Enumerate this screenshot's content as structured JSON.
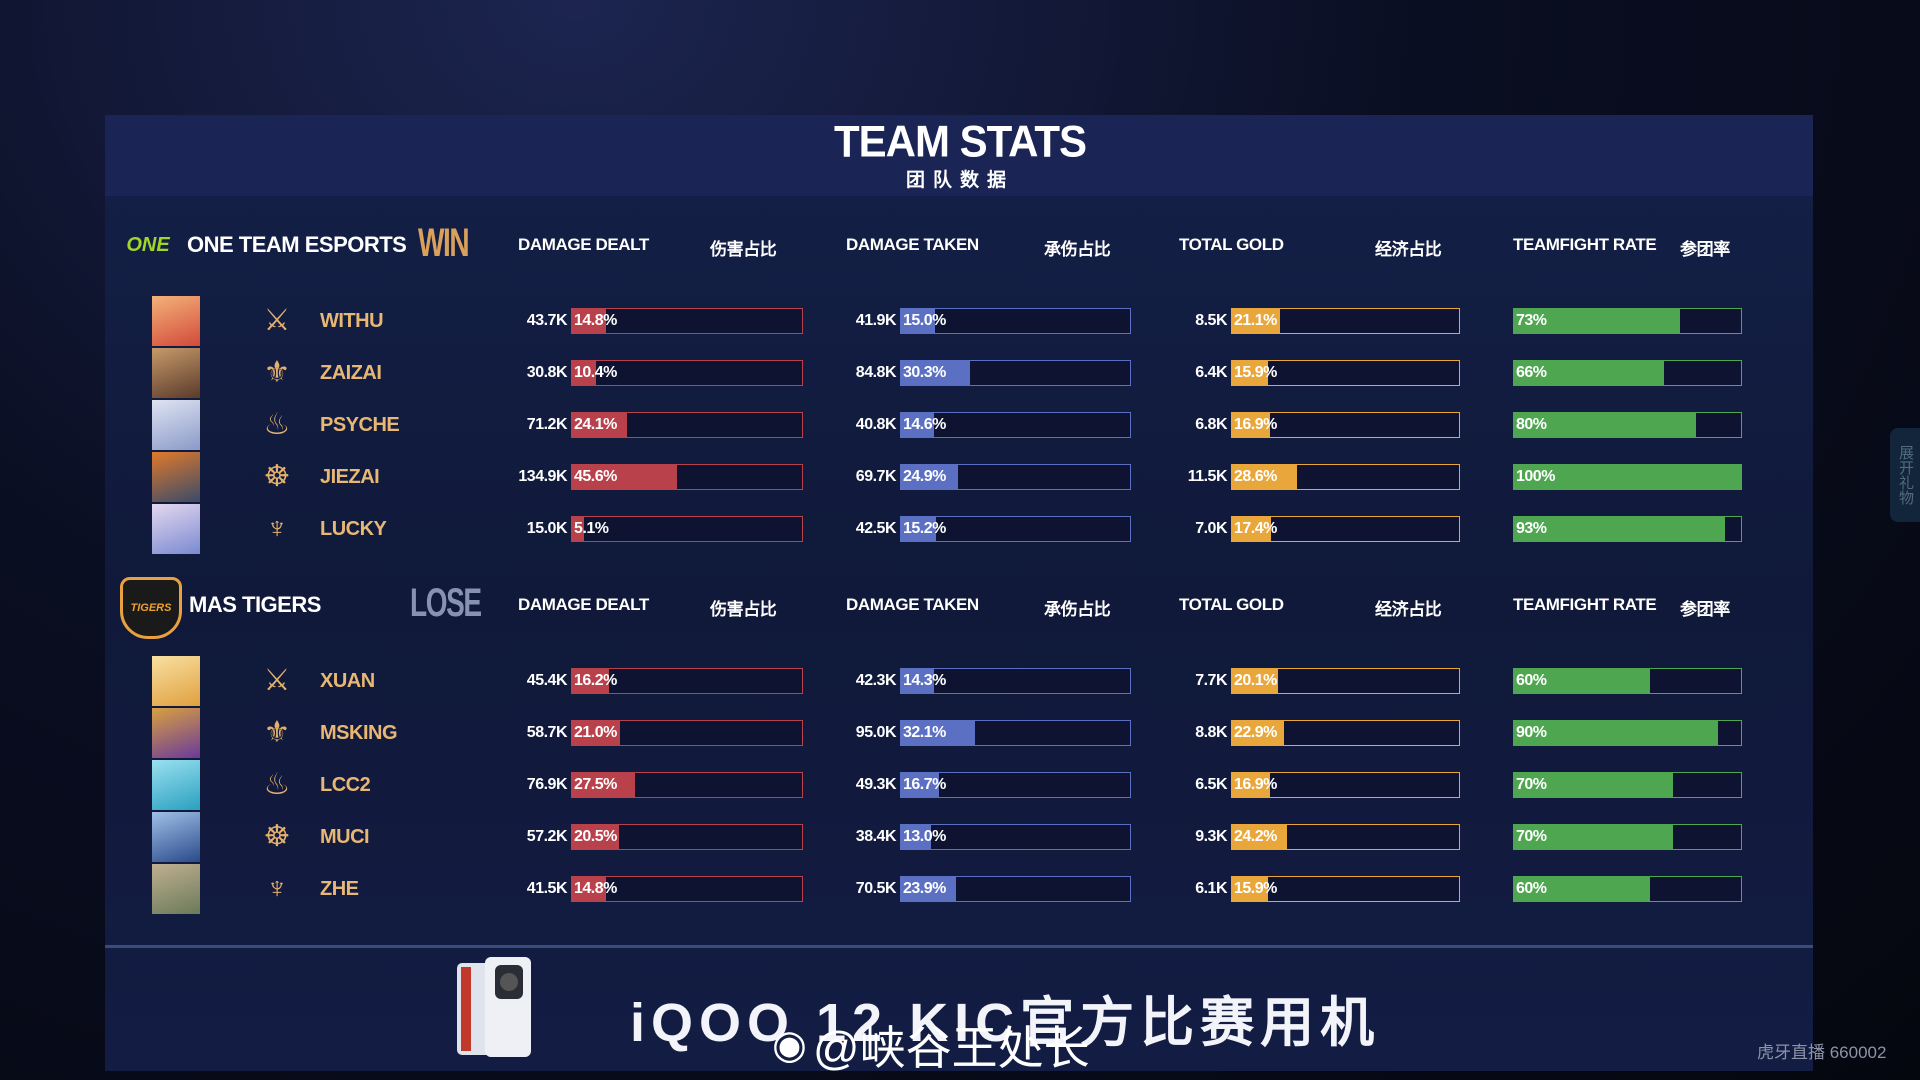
{
  "title": "TEAM STATS",
  "subtitle": "团队数据",
  "columns": {
    "damage_dealt": "DAMAGE DEALT",
    "damage_share": "伤害占比",
    "damage_taken": "DAMAGE TAKEN",
    "taken_share": "承伤占比",
    "total_gold": "TOTAL GOLD",
    "gold_share": "经济占比",
    "teamfight_rate": "TEAMFIGHT RATE",
    "teamfight_cn": "参团率"
  },
  "colors": {
    "damage": "#b8414b",
    "taken": "#5b70c2",
    "gold": "#e9a73b",
    "teamfight": "#4ea650",
    "player_name": "#e8b773",
    "win": "#d9a15c",
    "lose": "#8791b0"
  },
  "teams": [
    {
      "name": "ONE TEAM ESPORTS",
      "logo_text": "ONE",
      "result": "WIN",
      "players": [
        {
          "name": "WITHU",
          "role_icon": "clash-lane-icon",
          "damage": "43.7K",
          "damage_pct": 14.8,
          "taken": "41.9K",
          "taken_pct": 15.0,
          "gold": "8.5K",
          "gold_pct": 21.1,
          "teamfight": 73
        },
        {
          "name": "ZAIZAI",
          "role_icon": "jungle-icon",
          "damage": "30.8K",
          "damage_pct": 10.4,
          "taken": "84.8K",
          "taken_pct": 30.3,
          "gold": "6.4K",
          "gold_pct": 15.9,
          "teamfight": 66
        },
        {
          "name": "PSYCHE",
          "role_icon": "mid-lane-icon",
          "damage": "71.2K",
          "damage_pct": 24.1,
          "taken": "40.8K",
          "taken_pct": 14.6,
          "gold": "6.8K",
          "gold_pct": 16.9,
          "teamfight": 80
        },
        {
          "name": "JIEZAI",
          "role_icon": "farm-lane-icon",
          "damage": "134.9K",
          "damage_pct": 45.6,
          "taken": "69.7K",
          "taken_pct": 24.9,
          "gold": "11.5K",
          "gold_pct": 28.6,
          "teamfight": 100
        },
        {
          "name": "LUCKY",
          "role_icon": "roam-icon",
          "damage": "15.0K",
          "damage_pct": 5.1,
          "taken": "42.5K",
          "taken_pct": 15.2,
          "gold": "7.0K",
          "gold_pct": 17.4,
          "teamfight": 93
        }
      ]
    },
    {
      "name": "MAS TIGERS",
      "logo_text": "TIGERS",
      "result": "LOSE",
      "players": [
        {
          "name": "XUAN",
          "role_icon": "clash-lane-icon",
          "damage": "45.4K",
          "damage_pct": 16.2,
          "taken": "42.3K",
          "taken_pct": 14.3,
          "gold": "7.7K",
          "gold_pct": 20.1,
          "teamfight": 60
        },
        {
          "name": "MSKING",
          "role_icon": "jungle-icon",
          "damage": "58.7K",
          "damage_pct": 21.0,
          "taken": "95.0K",
          "taken_pct": 32.1,
          "gold": "8.8K",
          "gold_pct": 22.9,
          "teamfight": 90
        },
        {
          "name": "LCC2",
          "role_icon": "mid-lane-icon",
          "damage": "76.9K",
          "damage_pct": 27.5,
          "taken": "49.3K",
          "taken_pct": 16.7,
          "gold": "6.5K",
          "gold_pct": 16.9,
          "teamfight": 70
        },
        {
          "name": "MUCI",
          "role_icon": "farm-lane-icon",
          "damage": "57.2K",
          "damage_pct": 20.5,
          "taken": "38.4K",
          "taken_pct": 13.0,
          "gold": "9.3K",
          "gold_pct": 24.2,
          "teamfight": 70
        },
        {
          "name": "ZHE",
          "role_icon": "roam-icon",
          "damage": "41.5K",
          "damage_pct": 14.8,
          "taken": "70.5K",
          "taken_pct": 23.9,
          "gold": "6.1K",
          "gold_pct": 15.9,
          "teamfight": 60
        }
      ]
    }
  ],
  "sponsor": {
    "text": "iQOO 12  KIC官方比赛用机"
  },
  "watermark": {
    "weibo": "@峡谷王处长",
    "huya": "虎牙直播 660002"
  },
  "side_tab": "展开礼物"
}
